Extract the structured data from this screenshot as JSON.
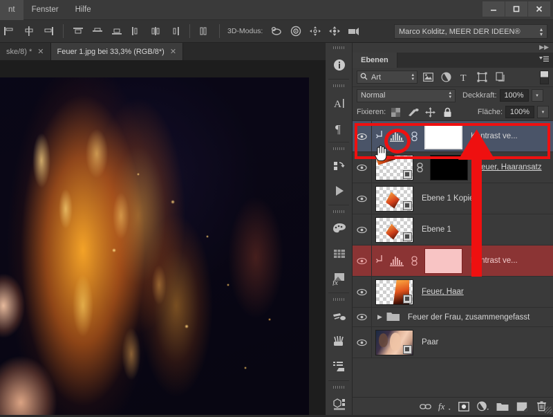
{
  "window": {
    "minimize_label": "—",
    "maximize_label": "❐",
    "close_label": "✕"
  },
  "menubar": {
    "items": [
      {
        "label": "nt"
      },
      {
        "label": "Fenster"
      },
      {
        "label": "Hilfe"
      }
    ]
  },
  "options_bar": {
    "align_icons": [
      "align-left-edges-icon",
      "align-horizontal-centers-icon",
      "align-right-edges-icon",
      "align-top-edges-icon",
      "align-vertical-centers-icon",
      "align-bottom-edges-icon",
      "distribute-left-icon",
      "distribute-center-icon",
      "distribute-right-icon",
      "distribute-spacing-icon"
    ],
    "mode3d_label": "3D-Modus:",
    "mode3d_icons": [
      "rotate-3d-icon",
      "roll-3d-icon",
      "drag-3d-icon",
      "slide-3d-icon",
      "scale-3d-camera-icon"
    ],
    "user_select": {
      "value": "Marco Kolditz, MEER DER IDEEN®"
    }
  },
  "document_tabs": [
    {
      "label": "ske/8) *",
      "close": "✕",
      "active": false
    },
    {
      "label": "Feuer 1.jpg bei 33,3%  (RGB/8*)",
      "close": "✕",
      "active": true
    }
  ],
  "dock_strip": {
    "icons": [
      "info-icon",
      "character-icon",
      "paragraph-icon",
      "history-icon",
      "actions-play-icon",
      "color-swatches-icon",
      "swatches-grid-icon",
      "styles-fx-icon",
      "brush-preset-icon",
      "brush-tips-icon",
      "tool-presets-icon",
      "3d-panel-icon"
    ]
  },
  "panel": {
    "collapse_left_label": "◀◀",
    "collapse_right_label": "▶▶",
    "tab_label": "Ebenen",
    "menu_icon": "panel-menu-icon",
    "filter": {
      "kind_label": "Art",
      "search_icon": "search-icon",
      "stepper": "⇕",
      "icons": [
        "filter-pixel-icon",
        "filter-adjustment-icon",
        "filter-type-icon",
        "filter-shape-icon",
        "filter-smartobject-icon"
      ],
      "toggle_name": "filter-enable-toggle"
    },
    "blend": {
      "mode_value": "Normal",
      "stepper": "⇕",
      "opacity_label": "Deckkraft:",
      "opacity_value": "100%",
      "arrow": "▾"
    },
    "lock": {
      "label": "Fixieren:",
      "icons": [
        "lock-transparency-icon",
        "lock-image-icon",
        "lock-position-icon",
        "lock-all-icon"
      ],
      "fill_label": "Fläche:",
      "fill_value": "100%",
      "arrow": "▾"
    },
    "layers": [
      {
        "name": "Kontrast ve...",
        "visible": true,
        "selected": true,
        "clipped": true,
        "clip_icon": "clipping-mask-icon",
        "adjustment_icon": "levels-adjustment-icon",
        "link_icon": "mask-link-icon",
        "mask": "white",
        "type": "adjustment",
        "highlight": "none"
      },
      {
        "name": "Feuer, Haaransatz",
        "visible": true,
        "selected": false,
        "clipped": false,
        "link_icon": "mask-link-icon",
        "mask": "black",
        "type": "pixel-with-mask",
        "underline": true,
        "highlight": "none"
      },
      {
        "name": "Ebene 1 Kopie",
        "visible": true,
        "selected": false,
        "type": "pixel",
        "highlight": "none"
      },
      {
        "name": "Ebene 1",
        "visible": true,
        "selected": false,
        "type": "pixel",
        "highlight": "none"
      },
      {
        "name": "Kontrast ve...",
        "visible": true,
        "selected": false,
        "clipped": true,
        "clip_icon": "clipping-mask-icon",
        "adjustment_icon": "levels-adjustment-icon",
        "link_icon": "mask-link-icon",
        "mask": "pink",
        "type": "adjustment",
        "highlight": "red"
      },
      {
        "name": "Feuer, Haar",
        "visible": true,
        "selected": false,
        "type": "pixel",
        "underline": true,
        "highlight": "none"
      },
      {
        "name": "Feuer der Frau, zusammengefasst",
        "visible": true,
        "selected": false,
        "type": "group",
        "expand_arrow": "▶",
        "folder_icon": "folder-icon",
        "highlight": "none"
      },
      {
        "name": "Paar",
        "visible": true,
        "selected": false,
        "type": "pixel",
        "highlight": "none"
      }
    ],
    "footer_icons": [
      "link-layers-icon",
      "layer-fx-icon",
      "add-layer-mask-icon",
      "new-adjustment-layer-icon",
      "new-group-icon",
      "new-layer-icon",
      "delete-layer-icon"
    ]
  },
  "annotations": {
    "rect_name": "red-highlight-rectangle",
    "circle_name": "red-highlight-circle",
    "arrow_name": "red-arrow-up",
    "cursor_name": "hand-cursor"
  },
  "colors": {
    "annotation_red": "#ef1010",
    "selected_layer": "#4a5468",
    "red_layer": "#8b3434",
    "panel_bg": "#3a3a3a"
  }
}
